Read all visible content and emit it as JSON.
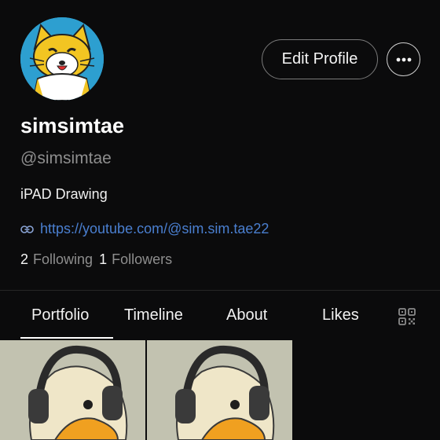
{
  "profile": {
    "display_name": "simsimtae",
    "handle": "@simsimtae",
    "bio": "iPAD Drawing",
    "link": "https://youtube.com/@sim.sim.tae22",
    "following_count": "2",
    "following_label": "Following",
    "followers_count": "1",
    "followers_label": "Followers"
  },
  "actions": {
    "edit_profile_label": "Edit Profile",
    "more_icon": "more-horizontal-icon"
  },
  "tabs": [
    {
      "label": "Portfolio",
      "active": true
    },
    {
      "label": "Timeline",
      "active": false
    },
    {
      "label": "About",
      "active": false
    },
    {
      "label": "Likes",
      "active": false
    }
  ],
  "icons": {
    "link": "link-icon",
    "qr": "qr-code-icon"
  },
  "colors": {
    "background": "#0b0b0c",
    "link": "#4a7fd0",
    "muted": "#8e8e8e",
    "avatar_bg": "#2d9fd0"
  }
}
